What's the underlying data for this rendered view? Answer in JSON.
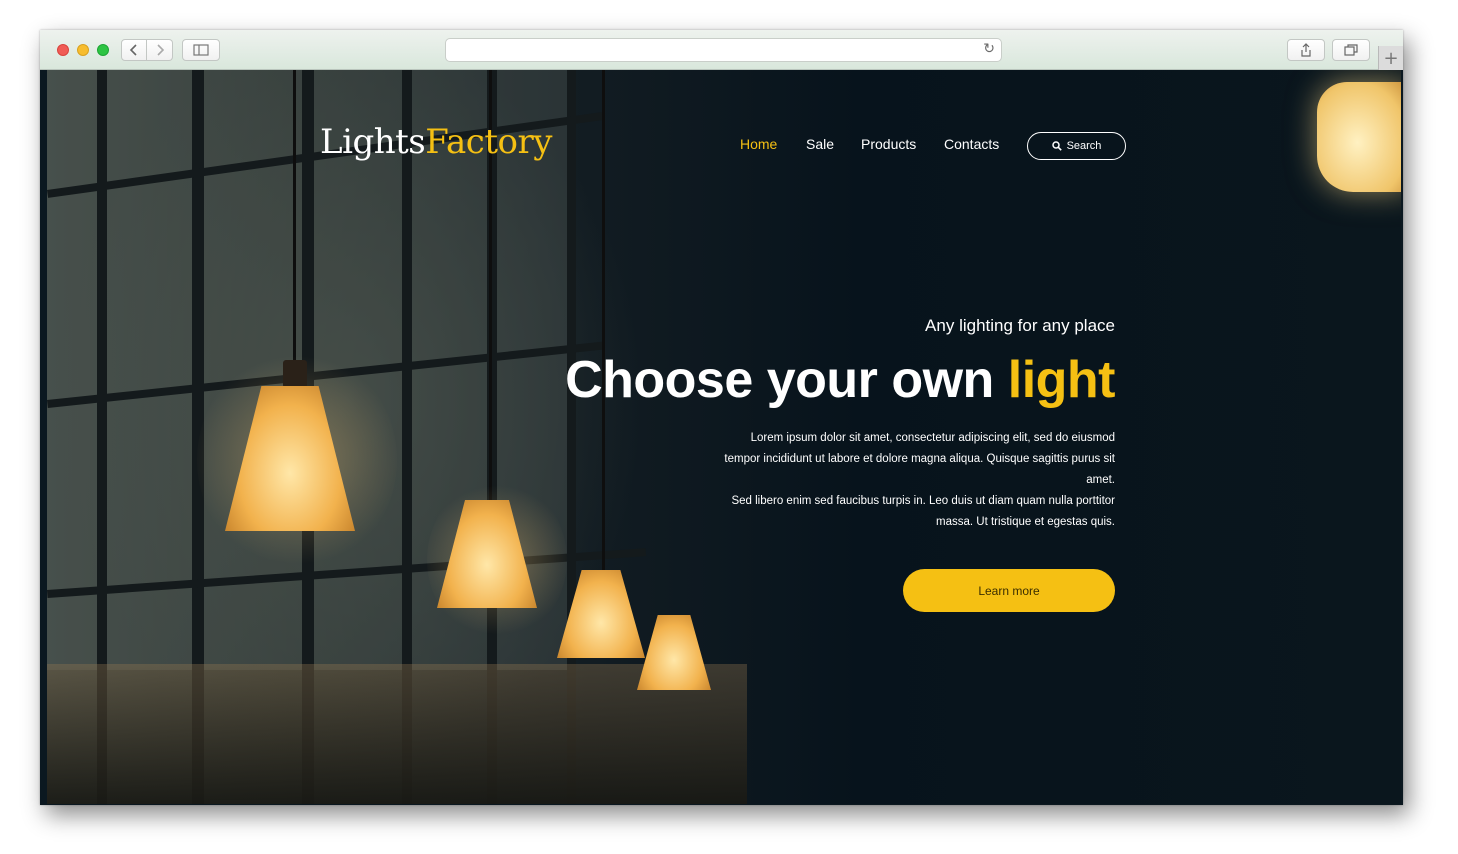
{
  "site": {
    "logo_main": "Lights",
    "logo_accent": "Factory"
  },
  "nav": {
    "items": [
      {
        "label": "Home",
        "active": true
      },
      {
        "label": "Sale",
        "active": false
      },
      {
        "label": "Products",
        "active": false
      },
      {
        "label": "Contacts",
        "active": false
      }
    ],
    "search_label": "Search"
  },
  "hero": {
    "subtitle": "Any lighting for any place",
    "headline_main": "Choose your own ",
    "headline_accent": "light",
    "body_line_1": "Lorem ipsum dolor sit amet, consectetur adipiscing elit, sed do eiusmod tempor incididunt ut labore et dolore magna aliqua. Quisque sagittis purus sit amet.",
    "body_line_2": "Sed libero enim sed faucibus turpis in. Leo duis ut diam quam nulla porttitor massa. Ut tristique et egestas quis.",
    "cta_label": "Learn more"
  },
  "colors": {
    "accent": "#f5c013",
    "background": "#07131c",
    "text": "#ffffff"
  },
  "icons": {
    "search": "search-icon",
    "reload": "reload-icon",
    "back": "chevron-left-icon",
    "forward": "chevron-right-icon",
    "sidebar": "sidebar-icon",
    "share": "share-icon",
    "tabs": "tabs-icon",
    "new_tab": "plus-icon"
  }
}
